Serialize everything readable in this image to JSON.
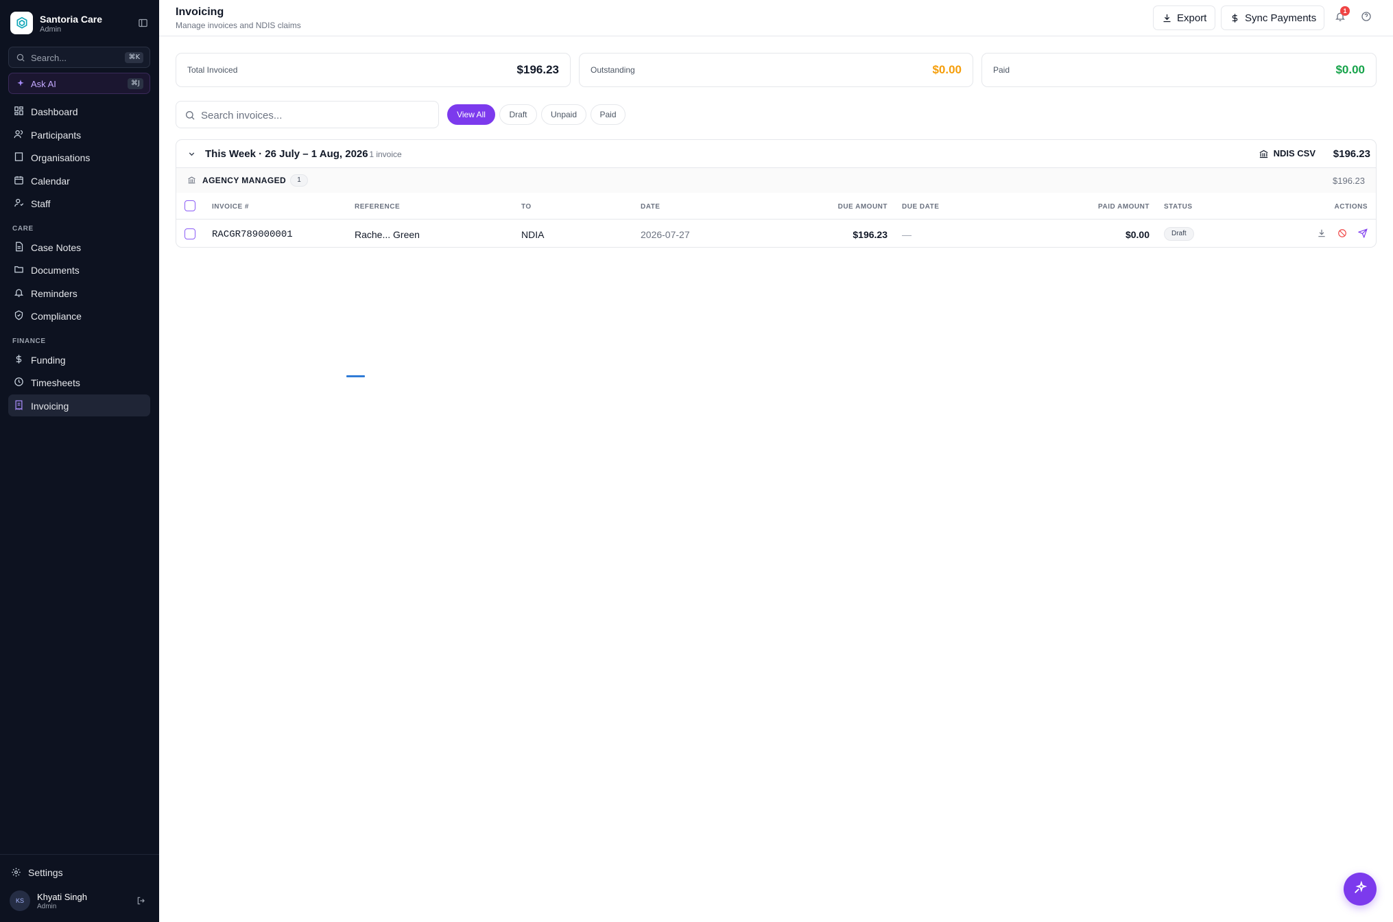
{
  "brand": {
    "name": "Santoria Care",
    "role": "Admin"
  },
  "sidebar": {
    "search_placeholder": "Search...",
    "search_shortcut": "⌘K",
    "ask_ai": "Ask AI",
    "ask_ai_shortcut": "⌘J",
    "items": [
      {
        "label": "Dashboard",
        "icon": "dashboard-icon"
      },
      {
        "label": "Participants",
        "icon": "users-icon"
      },
      {
        "label": "Organisations",
        "icon": "building-icon"
      },
      {
        "label": "Calendar",
        "icon": "calendar-icon"
      },
      {
        "label": "Staff",
        "icon": "staff-icon"
      }
    ],
    "care_label": "CARE",
    "care_items": [
      {
        "label": "Case Notes",
        "icon": "note-icon"
      },
      {
        "label": "Documents",
        "icon": "folder-icon"
      },
      {
        "label": "Reminders",
        "icon": "bell-icon"
      },
      {
        "label": "Compliance",
        "icon": "shield-icon"
      }
    ],
    "finance_label": "FINANCE",
    "finance_items": [
      {
        "label": "Funding",
        "icon": "dollar-icon"
      },
      {
        "label": "Timesheets",
        "icon": "clock-icon"
      },
      {
        "label": "Invoicing",
        "icon": "receipt-icon",
        "active": true
      }
    ],
    "settings": "Settings",
    "user": {
      "initials": "KS",
      "name": "Khyati Singh",
      "role": "Admin"
    }
  },
  "header": {
    "title": "Invoicing",
    "subtitle": "Manage invoices and NDIS claims",
    "export": "Export",
    "sync": "Sync Payments",
    "notification_count": "1"
  },
  "stats": {
    "total_label": "Total Invoiced",
    "total_value": "$196.23",
    "outstanding_label": "Outstanding",
    "outstanding_value": "$0.00",
    "paid_label": "Paid",
    "paid_value": "$0.00"
  },
  "colors": {
    "accent": "#7c3aed",
    "outstanding": "#f59e0b",
    "paid": "#16a34a",
    "sidebar_bg": "#0d1220"
  },
  "toolbar": {
    "search_placeholder": "Search invoices...",
    "filters": [
      "View All",
      "Draft",
      "Unpaid",
      "Paid"
    ],
    "active_filter": "View All"
  },
  "group": {
    "title": "This Week · 26 July – 1 Aug, 2026",
    "count": "· 1 invoice",
    "export_format": "NDIS CSV",
    "total": "$196.23",
    "subgroup": {
      "title": "AGENCY MANAGED",
      "count": "1",
      "total": "$196.23"
    },
    "columns": [
      "INVOICE #",
      "REFERENCE",
      "TO",
      "DATE",
      "DUE AMOUNT",
      "DUE DATE",
      "PAID AMOUNT",
      "STATUS",
      "ACTIONS"
    ],
    "rows": [
      {
        "invoice": "RACGR789000001",
        "reference": "Rache... Green",
        "to": "NDIA",
        "date": "2026-07-27",
        "due_amount": "$196.23",
        "due_date": "—",
        "paid_amount": "$0.00",
        "status": "Draft"
      }
    ]
  }
}
